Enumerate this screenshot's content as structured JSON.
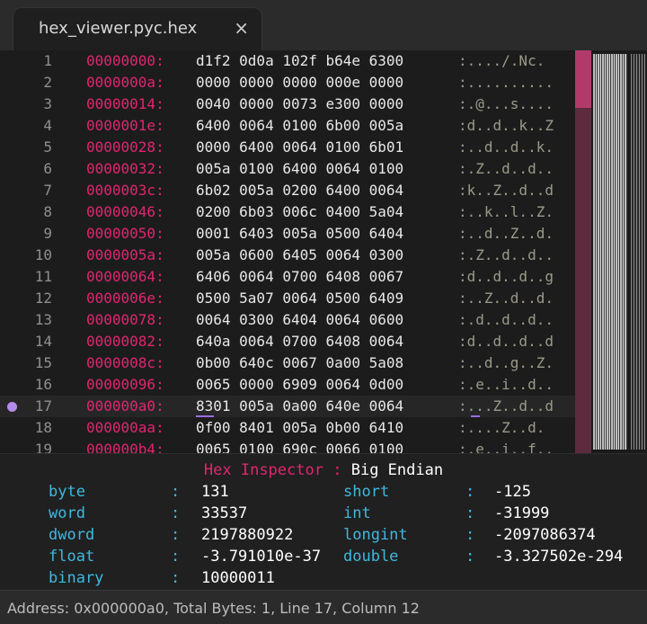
{
  "tab": {
    "title": "hex_viewer.pyc.hex",
    "close_glyph": "×"
  },
  "lines": [
    {
      "num": "1",
      "addr": "00000000:",
      "hex": "d1f2 0d0a 102f b64e 6300",
      "ascii": ":..../.Nc."
    },
    {
      "num": "2",
      "addr": "0000000a:",
      "hex": "0000 0000 0000 000e 0000",
      "ascii": ":.........."
    },
    {
      "num": "3",
      "addr": "00000014:",
      "hex": "0040 0000 0073 e300 0000",
      "ascii": ":.@...s...."
    },
    {
      "num": "4",
      "addr": "0000001e:",
      "hex": "6400 0064 0100 6b00 005a",
      "ascii": ":d..d..k..Z"
    },
    {
      "num": "5",
      "addr": "00000028:",
      "hex": "0000 6400 0064 0100 6b01",
      "ascii": ":..d..d..k."
    },
    {
      "num": "6",
      "addr": "00000032:",
      "hex": "005a 0100 6400 0064 0100",
      "ascii": ":.Z..d..d.."
    },
    {
      "num": "7",
      "addr": "0000003c:",
      "hex": "6b02 005a 0200 6400 0064",
      "ascii": ":k..Z..d..d"
    },
    {
      "num": "8",
      "addr": "00000046:",
      "hex": "0200 6b03 006c 0400 5a04",
      "ascii": ":..k..l..Z."
    },
    {
      "num": "9",
      "addr": "00000050:",
      "hex": "0001 6403 005a 0500 6404",
      "ascii": ":..d..Z..d."
    },
    {
      "num": "10",
      "addr": "0000005a:",
      "hex": "005a 0600 6405 0064 0300",
      "ascii": ":.Z..d..d.."
    },
    {
      "num": "11",
      "addr": "00000064:",
      "hex": "6406 0064 0700 6408 0067",
      "ascii": ":d..d..d..g"
    },
    {
      "num": "12",
      "addr": "0000006e:",
      "hex": "0500 5a07 0064 0500 6409",
      "ascii": ":..Z..d..d."
    },
    {
      "num": "13",
      "addr": "00000078:",
      "hex": "0064 0300 6404 0064 0600",
      "ascii": ":.d..d..d.."
    },
    {
      "num": "14",
      "addr": "00000082:",
      "hex": "640a 0064 0700 6408 0064",
      "ascii": ":d..d..d..d"
    },
    {
      "num": "15",
      "addr": "0000008c:",
      "hex": "0b00 640c 0067 0a00 5a08",
      "ascii": ":..d..g..Z."
    },
    {
      "num": "16",
      "addr": "00000096:",
      "hex": "0065 0000 6909 0064 0d00",
      "ascii": ":.e..i..d.."
    },
    {
      "num": "17",
      "addr": "000000a0:",
      "hex": "8301 005a 0a00 640e 0064",
      "ascii": ":...Z..d..d",
      "current": true
    },
    {
      "num": "18",
      "addr": "000000aa:",
      "hex": "0f00 8401 005a 0b00 6410",
      "ascii": ":....Z..d."
    },
    {
      "num": "19",
      "addr": "000000b4:",
      "hex": "0065 0100 690c 0066 0100",
      "ascii": ":.e..i..f.."
    }
  ],
  "inspector": {
    "title": "Hex Inspector",
    "separator": ":",
    "endian": "Big Endian",
    "colon": ":",
    "left": [
      {
        "label": "byte",
        "value": "131"
      },
      {
        "label": "word",
        "value": "33537"
      },
      {
        "label": "dword",
        "value": "2197880922"
      },
      {
        "label": "float",
        "value": "-3.791010e-37"
      },
      {
        "label": "binary",
        "value": "10000011"
      }
    ],
    "right": [
      {
        "label": "short",
        "value": "-125"
      },
      {
        "label": "int",
        "value": "-31999"
      },
      {
        "label": "longint",
        "value": "-2097086374"
      },
      {
        "label": "double",
        "value": "-3.327502e-294"
      }
    ]
  },
  "status": {
    "text": "Address: 0x000000a0, Total Bytes: 1, Line 17, Column 12"
  },
  "colors": {
    "address": "#e0266e",
    "label": "#3fb8e0",
    "marker": "#b48ce8",
    "scroll": "#b23a6a"
  }
}
